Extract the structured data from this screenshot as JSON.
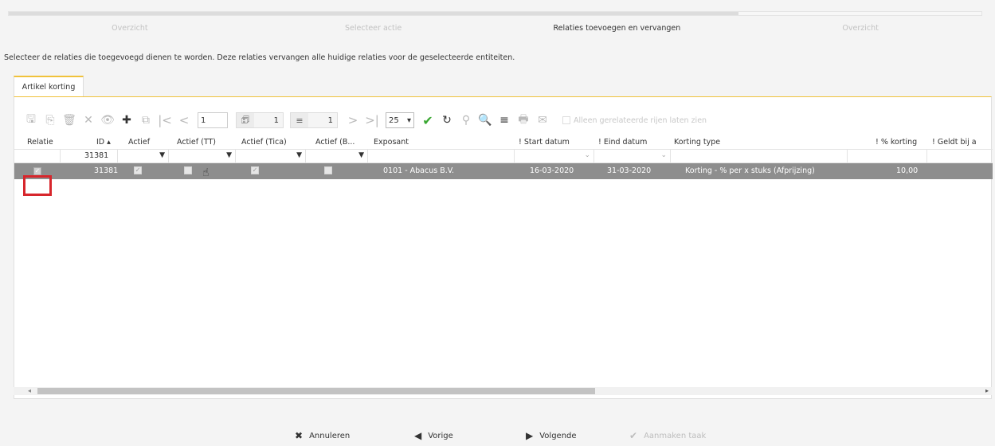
{
  "wizard": {
    "progress_percent": 75,
    "steps": [
      {
        "label": "Overzicht",
        "active": false
      },
      {
        "label": "Selecteer actie",
        "active": false
      },
      {
        "label": "Relaties toevoegen en vervangen",
        "active": true
      },
      {
        "label": "Overzicht",
        "active": false
      }
    ]
  },
  "intro_text": "Selecteer de relaties die toegevoegd dienen te worden. Deze relaties vervangen alle huidige relaties voor de geselecteerde entiteiten.",
  "tab": {
    "label": "Artikel korting"
  },
  "toolbar": {
    "page_input": "1",
    "page_count": "1",
    "record_count": "1",
    "page_size": "25",
    "filter_label": "Alleen gerelateerde rijen laten zien"
  },
  "grid": {
    "columns": [
      "Relatie",
      "ID ▴",
      "Actief",
      "Actief (TT)",
      "Actief (Tica)",
      "Actief (B...",
      "Exposant",
      "! Start datum",
      "! Eind datum",
      "Korting type",
      "! % korting",
      "! Geldt bij a"
    ],
    "filter_id": "31381",
    "row": {
      "relatie": "✓",
      "id": "31381",
      "actief": "✓",
      "actief_tt": "",
      "actief_tica": "✓",
      "actief_b": "",
      "exposant": "0101 - Abacus B.V.",
      "start_datum": "16-03-2020",
      "eind_datum": "31-03-2020",
      "korting_type": "Korting - % per x stuks (Afprijzing)",
      "korting_pct": "10,00"
    }
  },
  "footer": {
    "cancel": "Annuleren",
    "previous": "Vorige",
    "next": "Volgende",
    "create": "Aanmaken taak"
  },
  "colors": {
    "accent": "#f0c23b",
    "selected_row": "#8e8e8e",
    "highlight": "#d7262c",
    "confirm": "#3aa832"
  }
}
